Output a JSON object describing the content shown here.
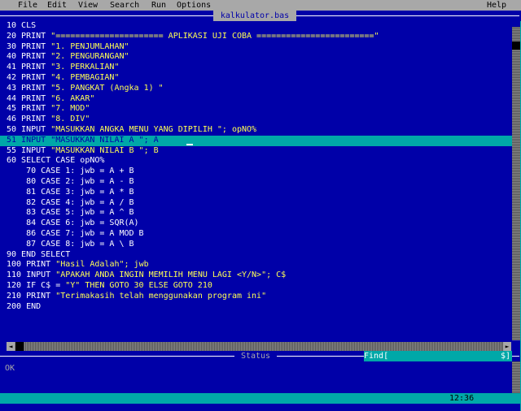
{
  "menu": {
    "file": "File",
    "edit": "Edit",
    "view": "View",
    "search": "Search",
    "run": "Run",
    "options": "Options",
    "help": "Help"
  },
  "editor": {
    "title": "kalkulator.bas",
    "lines": [
      {
        "code": "10 CLS",
        "str": ""
      },
      {
        "code": "20 PRINT ",
        "str": "\"====================== APLIKASI UJI COBA ========================\""
      },
      {
        "code": "30 PRINT ",
        "str": "\"1. PENJUMLAHAN\""
      },
      {
        "code": "40 PRINT ",
        "str": "\"2. PENGURANGAN\""
      },
      {
        "code": "41 PRINT ",
        "str": "\"3. PERKALIAN\""
      },
      {
        "code": "42 PRINT ",
        "str": "\"4. PEMBAGIAN\""
      },
      {
        "code": "43 PRINT ",
        "str": "\"5. PANGKAT (Angka 1) \""
      },
      {
        "code": "44 PRINT ",
        "str": "\"6. AKAR\""
      },
      {
        "code": "45 PRINT ",
        "str": "\"7. MOD\""
      },
      {
        "code": "46 PRINT ",
        "str": "\"8. DIV\""
      },
      {
        "code": "50 INPUT ",
        "str": "\"MASUKKAN ANGKA MENU YANG DIPILIH \"; opNO%"
      },
      {
        "code": "51 INPUT ",
        "str": "\"MASUKKAN NILAI A \"; A"
      },
      {
        "code": "55 INPUT ",
        "str": "\"MASUKKAN NILAI B \"; B"
      },
      {
        "code": "60 SELECT CASE opNO%",
        "str": ""
      },
      {
        "code": "    70 CASE 1: jwb = A + B",
        "str": ""
      },
      {
        "code": "    80 CASE 2: jwb = A - B",
        "str": ""
      },
      {
        "code": "    81 CASE 3: jwb = A * B",
        "str": ""
      },
      {
        "code": "    82 CASE 4: jwb = A / B",
        "str": ""
      },
      {
        "code": "    83 CASE 5: jwb = A ^ B",
        "str": ""
      },
      {
        "code": "    84 CASE 6: jwb = SQR(A)",
        "str": ""
      },
      {
        "code": "    86 CASE 7: jwb = A MOD B",
        "str": ""
      },
      {
        "code": "    87 CASE 8: jwb = A \\ B",
        "str": ""
      },
      {
        "code": "90 END SELECT",
        "str": ""
      },
      {
        "code": "100 PRINT ",
        "str": "\"Hasil Adalah\"; jwb"
      },
      {
        "code": "110 INPUT ",
        "str": "\"APAKAH ANDA INGIN MEMILIH MENU LAGI <Y/N>\"; C$"
      },
      {
        "code": "120 IF C$ = ",
        "str": "\"Y\" THEN GOTO 30 ELSE GOTO 210"
      },
      {
        "code": "210 PRINT ",
        "str": "\"Terimakasih telah menggunakan program ini\""
      },
      {
        "code": "200 END",
        "str": ""
      }
    ],
    "selected_index": 11
  },
  "scrollbar": {
    "left_arrow": "◄",
    "right_arrow": "►"
  },
  "status": {
    "title": "Status",
    "find_label": "Find[",
    "find_end": "$]",
    "message": "OK"
  },
  "bottom": {
    "clock": "12:36"
  }
}
